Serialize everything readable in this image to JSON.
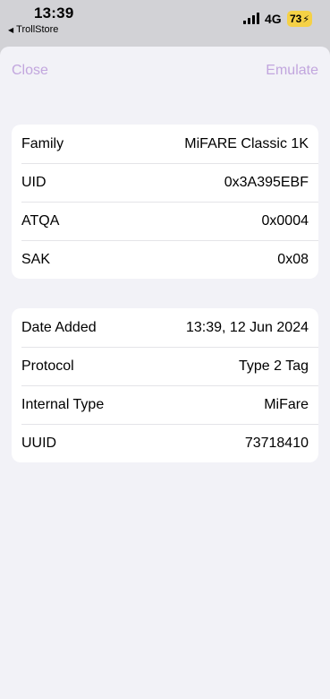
{
  "status_bar": {
    "time": "13:39",
    "back_app": "TrollStore",
    "network": "4G",
    "battery": "73"
  },
  "nav": {
    "close_label": "Close",
    "emulate_label": "Emulate"
  },
  "colors": {
    "accent": "#c2a6de",
    "battery": "#f5d146",
    "sheet_background": "#f2f2f7"
  },
  "tag_info": [
    {
      "label": "Family",
      "value": "MiFARE Classic 1K"
    },
    {
      "label": "UID",
      "value": "0x3A395EBF"
    },
    {
      "label": "ATQA",
      "value": "0x0004"
    },
    {
      "label": "SAK",
      "value": "0x08"
    }
  ],
  "metadata": [
    {
      "label": "Date Added",
      "value": "13:39, 12 Jun 2024"
    },
    {
      "label": "Protocol",
      "value": "Type 2 Tag"
    },
    {
      "label": "Internal Type",
      "value": "MiFare"
    },
    {
      "label": "UUID",
      "value": "73718410"
    }
  ]
}
